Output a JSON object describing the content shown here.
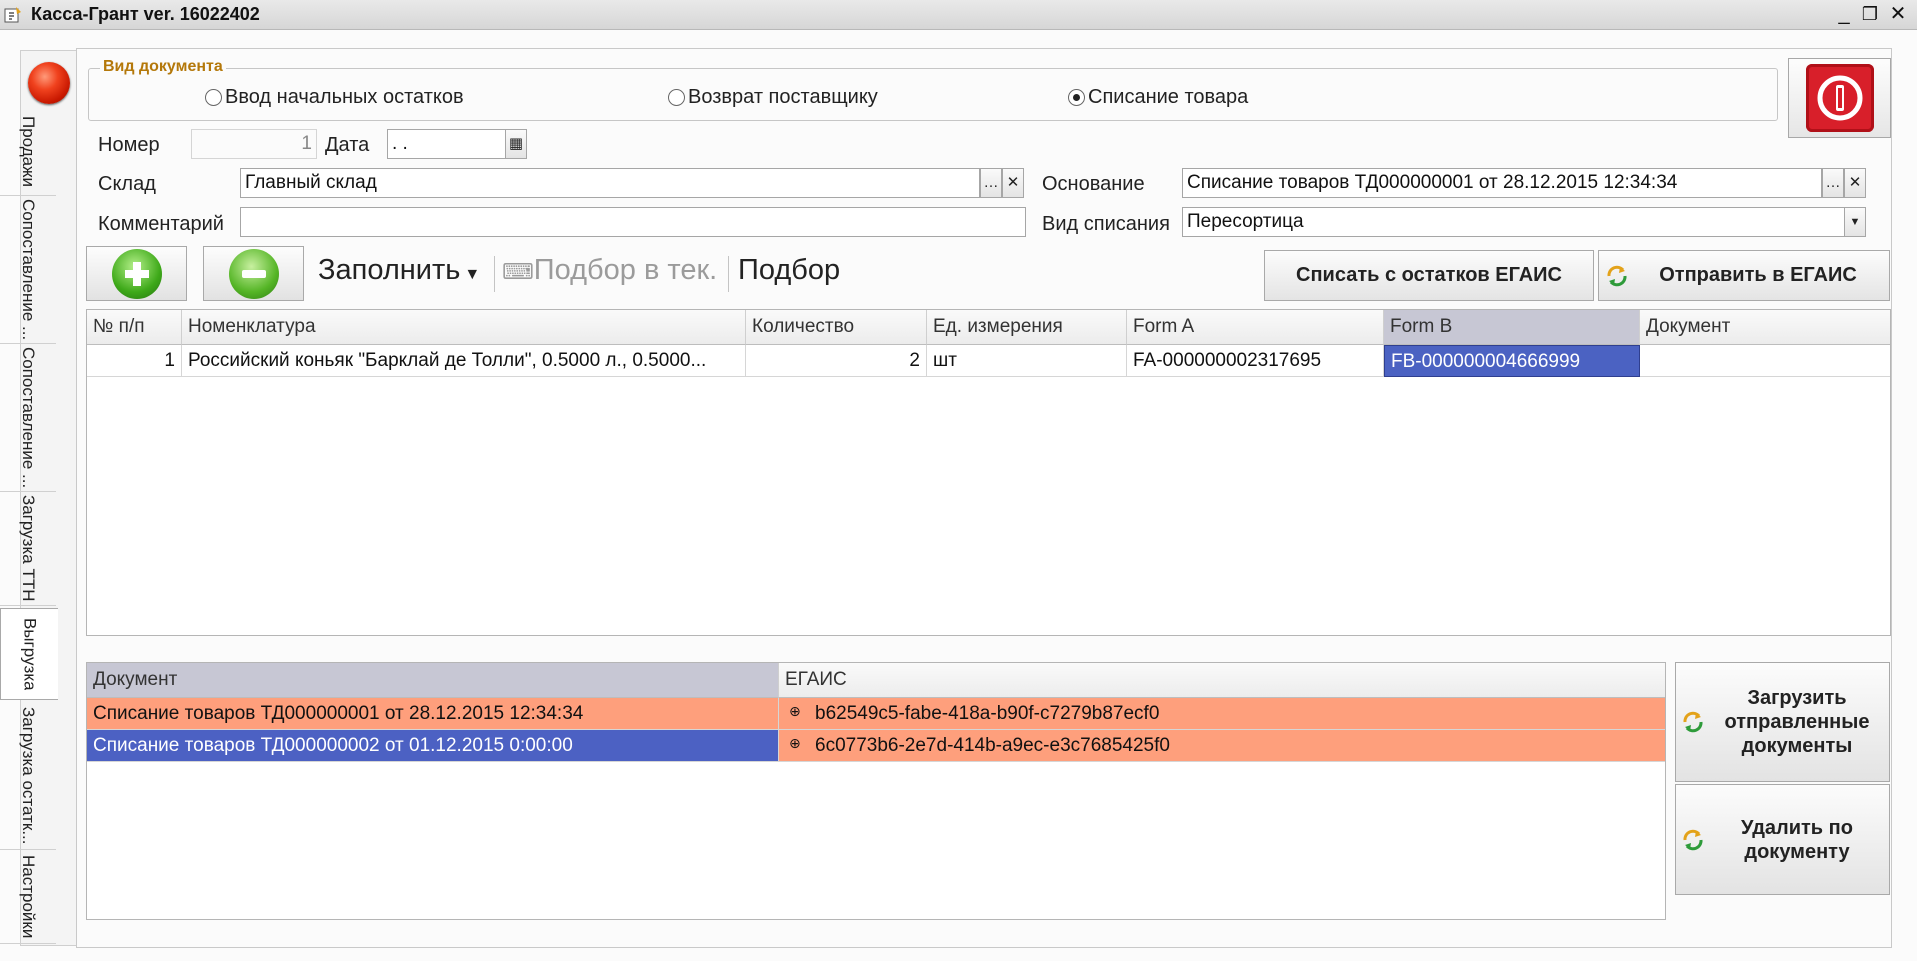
{
  "window": {
    "title": "Касса-Грант ver. 16022402"
  },
  "side_tabs": [
    "Продажи",
    "Сопоставление ...",
    "Сопоставление ...",
    "Загрузка ТТН",
    "Выгрузка",
    "Загрузка остатк...",
    "Настройки"
  ],
  "doc_type": {
    "legend": "Вид документа",
    "options": [
      "Ввод начальных остатков",
      "Возврат поставщику",
      "Списание товара"
    ],
    "selected": 2
  },
  "fields": {
    "number_label": "Номер",
    "number_value": "1",
    "date_label": "Дата",
    "date_value": " . .",
    "warehouse_label": "Склад",
    "warehouse_value": "Главный склад",
    "comment_label": "Комментарий",
    "comment_value": "",
    "basis_label": "Основание",
    "basis_value": "Списание товаров ТД000000001 от 28.12.2015 12:34:34",
    "writeoff_label": "Вид списания",
    "writeoff_value": "Пересортица"
  },
  "toolbar": {
    "fill": "Заполнить",
    "pick_current": "Подбор в тек.",
    "pick": "Подбор",
    "write_off_egais": "Списать с остатков ЕГАИС",
    "send_egais": "Отправить в ЕГАИС"
  },
  "items_table": {
    "headers": [
      "№ п/п",
      "Номенклатура",
      "Количество",
      "Ед. измерения",
      "Form A",
      "Form B",
      "Документ"
    ],
    "rows": [
      [
        "1",
        "Российский коньяк \"Барклай де Толли\", 0.5000 л., 0.5000...",
        "2",
        "шт",
        "FA-000000002317695",
        "FB-000000004666999",
        ""
      ]
    ]
  },
  "docs_table": {
    "headers": [
      "Документ",
      "ЕГАИС"
    ],
    "rows": [
      [
        "Списание товаров ТД000000001 от 28.12.2015 12:34:34",
        "b62549c5-fabe-418a-b90f-c7279b87ecf0"
      ],
      [
        "Списание товаров ТД000000002 от 01.12.2015 0:00:00",
        "6c0773b6-2e7d-414b-a9ec-e3c7685425f0"
      ]
    ]
  },
  "side_buttons": {
    "load_sent": "Загрузить отправленные документы",
    "delete_by_doc": "Удалить по документу"
  },
  "colors": {
    "row_highlight": "#fe9f7c",
    "row_selected": "#4c61c3",
    "legend": "#b4780a",
    "power": "#d81f2a"
  }
}
